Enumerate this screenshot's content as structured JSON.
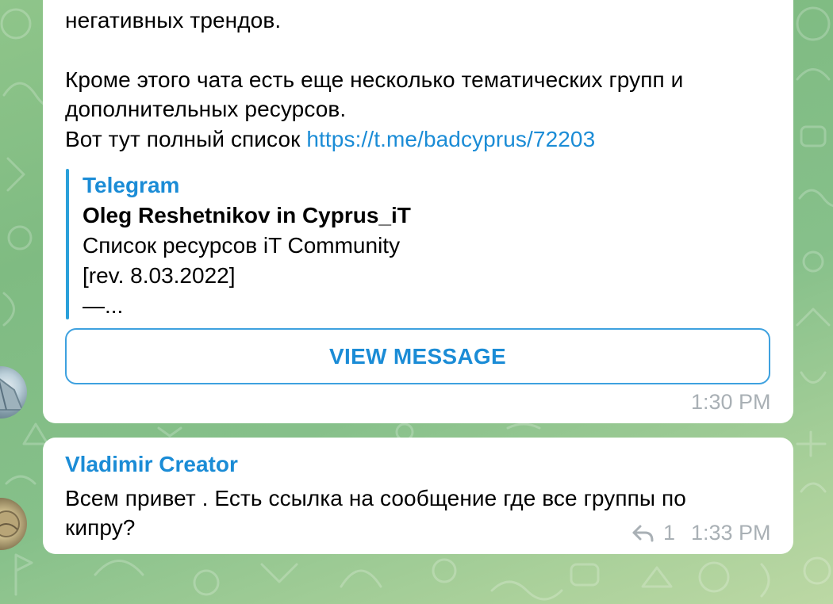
{
  "message1": {
    "line_top": "негативных трендов.",
    "para_line1": "Кроме этого чата есть еще несколько тематических групп и",
    "para_line2": "дополнительных ресурсов.",
    "link_prefix": "Вот тут полный список",
    "link_url": "https://t.me/badcyprus/72203",
    "preview": {
      "site": "Telegram",
      "title": "Oleg Reshetnikov in Cyprus_iT",
      "line1": "Список ресурсов iT Community",
      "line2": "[rev. 8.03.2022]",
      "line3": "—..."
    },
    "button_label": "VIEW MESSAGE",
    "time": "1:30 PM"
  },
  "message2": {
    "sender": "Vladimir Creator",
    "line1": "Всем привет . Есть ссылка на сообщение где все группы по",
    "line2": "кипру?",
    "reply_count": "1",
    "time": "1:33 PM"
  },
  "icons": {
    "reply": "reply-arrow-icon"
  },
  "colors": {
    "link": "#1b8cd6",
    "accent_bar": "#2aa0da",
    "timestamp": "#a9b0b5",
    "background": "#86c08a"
  }
}
